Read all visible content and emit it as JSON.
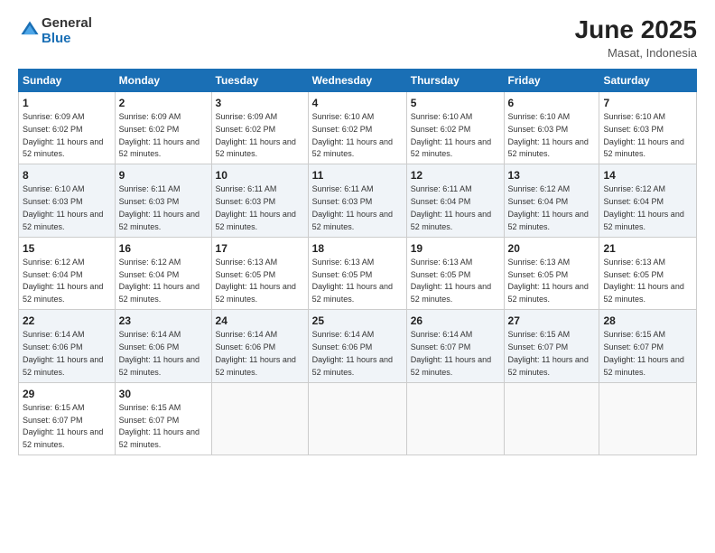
{
  "logo": {
    "general": "General",
    "blue": "Blue"
  },
  "title": "June 2025",
  "location": "Masat, Indonesia",
  "days_header": [
    "Sunday",
    "Monday",
    "Tuesday",
    "Wednesday",
    "Thursday",
    "Friday",
    "Saturday"
  ],
  "weeks": [
    [
      {
        "day": "1",
        "sunrise": "6:09 AM",
        "sunset": "6:02 PM",
        "daylight": "11 hours and 52 minutes."
      },
      {
        "day": "2",
        "sunrise": "6:09 AM",
        "sunset": "6:02 PM",
        "daylight": "11 hours and 52 minutes."
      },
      {
        "day": "3",
        "sunrise": "6:09 AM",
        "sunset": "6:02 PM",
        "daylight": "11 hours and 52 minutes."
      },
      {
        "day": "4",
        "sunrise": "6:10 AM",
        "sunset": "6:02 PM",
        "daylight": "11 hours and 52 minutes."
      },
      {
        "day": "5",
        "sunrise": "6:10 AM",
        "sunset": "6:02 PM",
        "daylight": "11 hours and 52 minutes."
      },
      {
        "day": "6",
        "sunrise": "6:10 AM",
        "sunset": "6:03 PM",
        "daylight": "11 hours and 52 minutes."
      },
      {
        "day": "7",
        "sunrise": "6:10 AM",
        "sunset": "6:03 PM",
        "daylight": "11 hours and 52 minutes."
      }
    ],
    [
      {
        "day": "8",
        "sunrise": "6:10 AM",
        "sunset": "6:03 PM",
        "daylight": "11 hours and 52 minutes."
      },
      {
        "day": "9",
        "sunrise": "6:11 AM",
        "sunset": "6:03 PM",
        "daylight": "11 hours and 52 minutes."
      },
      {
        "day": "10",
        "sunrise": "6:11 AM",
        "sunset": "6:03 PM",
        "daylight": "11 hours and 52 minutes."
      },
      {
        "day": "11",
        "sunrise": "6:11 AM",
        "sunset": "6:03 PM",
        "daylight": "11 hours and 52 minutes."
      },
      {
        "day": "12",
        "sunrise": "6:11 AM",
        "sunset": "6:04 PM",
        "daylight": "11 hours and 52 minutes."
      },
      {
        "day": "13",
        "sunrise": "6:12 AM",
        "sunset": "6:04 PM",
        "daylight": "11 hours and 52 minutes."
      },
      {
        "day": "14",
        "sunrise": "6:12 AM",
        "sunset": "6:04 PM",
        "daylight": "11 hours and 52 minutes."
      }
    ],
    [
      {
        "day": "15",
        "sunrise": "6:12 AM",
        "sunset": "6:04 PM",
        "daylight": "11 hours and 52 minutes."
      },
      {
        "day": "16",
        "sunrise": "6:12 AM",
        "sunset": "6:04 PM",
        "daylight": "11 hours and 52 minutes."
      },
      {
        "day": "17",
        "sunrise": "6:13 AM",
        "sunset": "6:05 PM",
        "daylight": "11 hours and 52 minutes."
      },
      {
        "day": "18",
        "sunrise": "6:13 AM",
        "sunset": "6:05 PM",
        "daylight": "11 hours and 52 minutes."
      },
      {
        "day": "19",
        "sunrise": "6:13 AM",
        "sunset": "6:05 PM",
        "daylight": "11 hours and 52 minutes."
      },
      {
        "day": "20",
        "sunrise": "6:13 AM",
        "sunset": "6:05 PM",
        "daylight": "11 hours and 52 minutes."
      },
      {
        "day": "21",
        "sunrise": "6:13 AM",
        "sunset": "6:05 PM",
        "daylight": "11 hours and 52 minutes."
      }
    ],
    [
      {
        "day": "22",
        "sunrise": "6:14 AM",
        "sunset": "6:06 PM",
        "daylight": "11 hours and 52 minutes."
      },
      {
        "day": "23",
        "sunrise": "6:14 AM",
        "sunset": "6:06 PM",
        "daylight": "11 hours and 52 minutes."
      },
      {
        "day": "24",
        "sunrise": "6:14 AM",
        "sunset": "6:06 PM",
        "daylight": "11 hours and 52 minutes."
      },
      {
        "day": "25",
        "sunrise": "6:14 AM",
        "sunset": "6:06 PM",
        "daylight": "11 hours and 52 minutes."
      },
      {
        "day": "26",
        "sunrise": "6:14 AM",
        "sunset": "6:07 PM",
        "daylight": "11 hours and 52 minutes."
      },
      {
        "day": "27",
        "sunrise": "6:15 AM",
        "sunset": "6:07 PM",
        "daylight": "11 hours and 52 minutes."
      },
      {
        "day": "28",
        "sunrise": "6:15 AM",
        "sunset": "6:07 PM",
        "daylight": "11 hours and 52 minutes."
      }
    ],
    [
      {
        "day": "29",
        "sunrise": "6:15 AM",
        "sunset": "6:07 PM",
        "daylight": "11 hours and 52 minutes."
      },
      {
        "day": "30",
        "sunrise": "6:15 AM",
        "sunset": "6:07 PM",
        "daylight": "11 hours and 52 minutes."
      },
      null,
      null,
      null,
      null,
      null
    ]
  ]
}
